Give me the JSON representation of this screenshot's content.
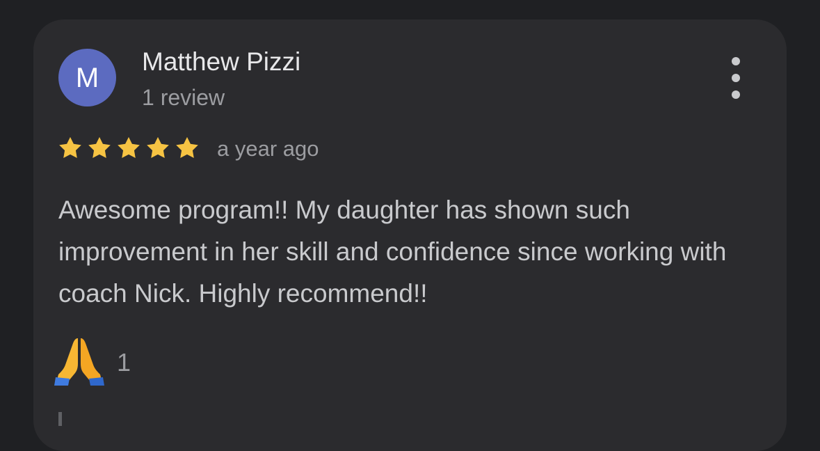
{
  "review": {
    "avatar_letter": "M",
    "avatar_color": "#5c6bc0",
    "reviewer_name": "Matthew Pizzi",
    "reviewer_subtitle": "1 review",
    "rating": 5,
    "rating_max": 5,
    "star_color": "#f6c343",
    "time_ago": "a year ago",
    "text": "Awesome program!! My daughter has shown such improvement in her skill and confidence since working with coach Nick. Highly recommend!!",
    "reaction_icon": "folded-hands-icon",
    "reaction_count": "1",
    "more_icon": "more-vert-icon"
  }
}
